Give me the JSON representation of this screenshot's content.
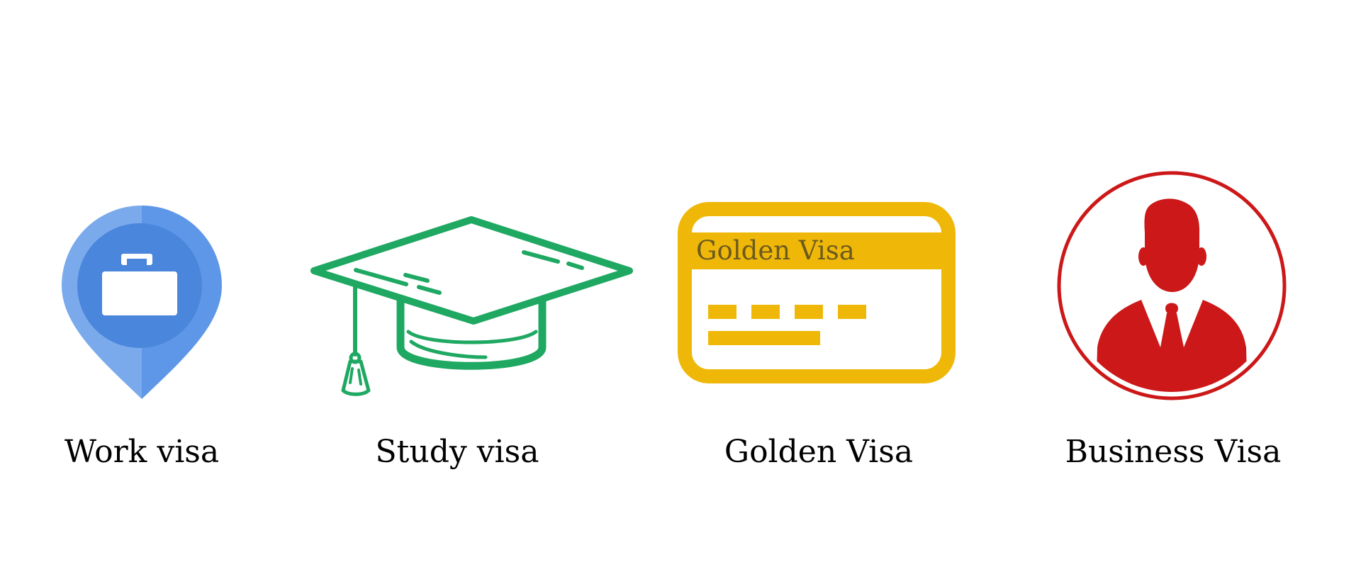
{
  "visas": [
    {
      "label": "Work visa",
      "icon": "briefcase-location-pin-icon",
      "colors": {
        "light": "#7aaaeb",
        "mid": "#5e97e8",
        "inner": "#4a86dc",
        "glyph": "#ffffff"
      }
    },
    {
      "label": "Study visa",
      "icon": "graduation-cap-icon",
      "colors": {
        "stroke": "#1fa862"
      }
    },
    {
      "label": "Golden Visa",
      "icon": "golden-visa-card-icon",
      "card_title": "Golden Visa",
      "colors": {
        "card": "#efb808",
        "title_text": "#6b5a1e"
      }
    },
    {
      "label": "Business Visa",
      "icon": "businessman-avatar-icon",
      "colors": {
        "accent": "#cc1818"
      }
    }
  ]
}
